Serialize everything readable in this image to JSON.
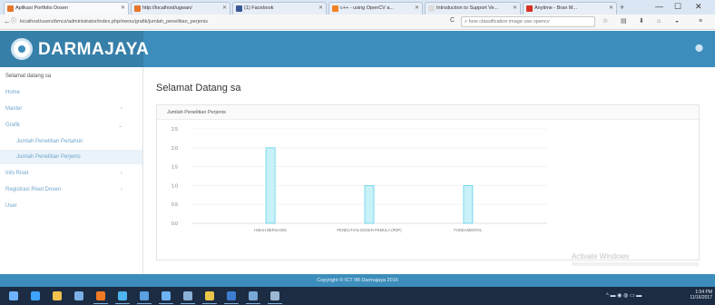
{
  "browser": {
    "tabs": [
      {
        "title": "Aplikasi Portfolio Dosen",
        "favicon_color": "#e6752c",
        "active": true
      },
      {
        "title": "http://localhost/ugwan/",
        "favicon_color": "#e6752c",
        "active": false
      },
      {
        "title": "(1) Facebook",
        "favicon_color": "#3b5998",
        "active": false
      },
      {
        "title": "c++ - using OpenCV a...",
        "favicon_color": "#f48024",
        "active": false
      },
      {
        "title": "Introduction to Support Ve...",
        "favicon_color": "#dddddd",
        "active": false
      },
      {
        "title": "Anytime - Bran M...",
        "favicon_color": "#d93025",
        "active": false
      }
    ],
    "new_tab_label": "+",
    "window_controls": {
      "minimize": "—",
      "maximize": "☐",
      "close": "✕"
    },
    "url": "localhost/users/bmcs/administrator/index.php/menu/grafik/jumlah_penelitian_perjenis",
    "search_text": "how classification image use opencv",
    "nav": {
      "back": "←",
      "info": "ⓘ",
      "reload": "C"
    },
    "toolbar_icons": {
      "bookmark": "☆",
      "library": "▤",
      "download": "⬇",
      "home": "⌂",
      "pocket": "◒",
      "menu": "≡"
    }
  },
  "header": {
    "logo_text": "DARMAJAYA",
    "right_icon": "⬤"
  },
  "sidebar": {
    "user_label": "Selamat datang sa",
    "items": [
      {
        "label": "Home",
        "chevron": ""
      },
      {
        "label": "Master",
        "chevron": "‹"
      },
      {
        "label": "Grafik",
        "chevron": "⌄"
      }
    ],
    "sub_items": [
      {
        "label": "Jumlah Penelitian Pertahun",
        "active": false
      },
      {
        "label": "Jumlah Penelitian Perjenis",
        "active": true
      }
    ],
    "items_after": [
      {
        "label": "Info Riset",
        "chevron": "‹"
      },
      {
        "label": "Registrasi Riset Dosen",
        "chevron": "‹"
      },
      {
        "label": "User",
        "chevron": ""
      }
    ]
  },
  "main": {
    "page_title": "Selamat Datang sa",
    "panel_title": "Jumlah Penelitian Perjenis",
    "watermark": "Activate Windows"
  },
  "chart_data": {
    "type": "bar",
    "title": "",
    "xlabel": "",
    "ylabel": "",
    "categories": [
      "HIBAH BERSAING",
      "PENELITIAN DOSEN PEMULA (PDP)",
      "FUNDAMENTAL"
    ],
    "values": [
      2.0,
      1.0,
      1.0
    ],
    "ylim": [
      0,
      2.5
    ],
    "y_ticks": [
      0.0,
      0.5,
      1.0,
      1.5,
      2.0,
      2.5
    ],
    "y_tick_labels": [
      "0.0",
      "0.5",
      "1.0",
      "1.5",
      "2.0",
      "2.5"
    ],
    "bar_fill": "#c9f1f8",
    "bar_stroke": "#5fd4e8",
    "grid": true
  },
  "footer": {
    "text": "Copyright © ICT IIB Darmajaya 2016"
  },
  "taskbar": {
    "apps": [
      {
        "name": "start",
        "color": "#6fb3ff"
      },
      {
        "name": "ie",
        "color": "#3ea2ff"
      },
      {
        "name": "explorer-folder",
        "color": "#f2c14e"
      },
      {
        "name": "store",
        "color": "#7ab0e6"
      },
      {
        "name": "firefox",
        "color": "#f07a24"
      },
      {
        "name": "chrome",
        "color": "#4db5f0"
      },
      {
        "name": "onenote",
        "color": "#5aa0e0"
      },
      {
        "name": "explorer",
        "color": "#6db2f2"
      },
      {
        "name": "sublime",
        "color": "#8ab0d6"
      },
      {
        "name": "slack",
        "color": "#e9c54a"
      },
      {
        "name": "app-blue",
        "color": "#3c7dd0"
      },
      {
        "name": "app-doc",
        "color": "#78a8d8"
      },
      {
        "name": "app-tool",
        "color": "#9bb8d4"
      }
    ],
    "tray": "^ ▬ ◉ ◍ ▭ ▬",
    "clock_time": "1:54 PM",
    "clock_date": "11/16/2017"
  }
}
